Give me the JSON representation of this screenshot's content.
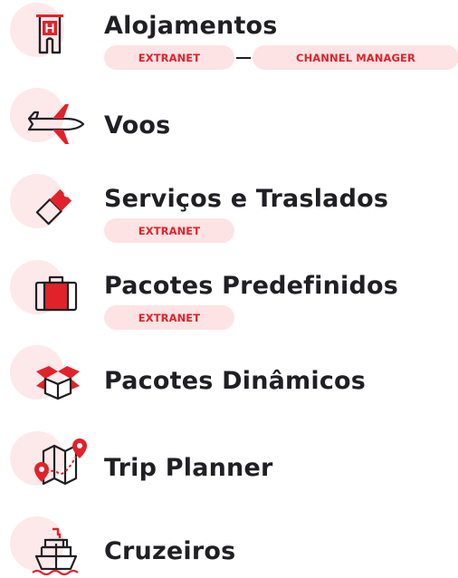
{
  "products": [
    {
      "id": "alojamentos",
      "icon": "hotel-icon",
      "title": "Alojamentos",
      "badges": [
        "EXTRANET",
        "CHANNEL MANAGER"
      ]
    },
    {
      "id": "voos",
      "icon": "airplane-icon",
      "title": "Voos",
      "badges": []
    },
    {
      "id": "servicos",
      "icon": "ticket-icon",
      "title": "Serviços e Traslados",
      "badges": [
        "EXTRANET"
      ]
    },
    {
      "id": "pacotes-predefinidos",
      "icon": "suitcase-icon",
      "title": "Pacotes Predefinidos",
      "badges": [
        "EXTRANET"
      ]
    },
    {
      "id": "pacotes-dinamicos",
      "icon": "open-box-icon",
      "title": "Pacotes Dinâmicos",
      "badges": []
    },
    {
      "id": "trip-planner",
      "icon": "map-route-icon",
      "title": "Trip Planner",
      "badges": []
    },
    {
      "id": "cruzeiros",
      "icon": "ship-icon",
      "title": "Cruzeiros",
      "badges": []
    }
  ],
  "colors": {
    "accent": "#e2222a",
    "text": "#1f1f24",
    "badge_bg": "#fde3e4",
    "blob_bg": "#fde9ea"
  }
}
